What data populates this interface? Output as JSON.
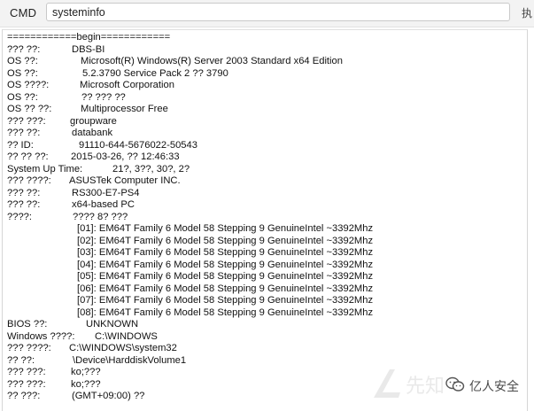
{
  "toolbar": {
    "label": "CMD",
    "input_value": "systeminfo",
    "run_button_label": "执"
  },
  "output": {
    "lines": [
      {
        "text": "============begin============",
        "indent": 0
      },
      {
        "key": "??? ??:",
        "value": "DBS-BI",
        "indent": 73
      },
      {
        "key": "OS ??:",
        "value": "Microsoft(R) Windows(R) Server 2003 Standard x64 Edition",
        "indent": 83
      },
      {
        "key": "OS ??:",
        "value": "5.2.3790 Service Pack 2 ?? 3790",
        "indent": 85
      },
      {
        "key": "OS ????:",
        "value": "Microsoft Corporation",
        "indent": 82
      },
      {
        "key": "OS ??:",
        "value": "?? ??? ??",
        "indent": 84
      },
      {
        "key": "OS ?? ??:",
        "value": "Multiprocessor Free",
        "indent": 83
      },
      {
        "key": "??? ???:",
        "value": "groupware",
        "indent": 71
      },
      {
        "key": "??? ??:",
        "value": "databank",
        "indent": 73
      },
      {
        "key": "?? ID:",
        "value": "91110-644-5676022-50543",
        "indent": 81
      },
      {
        "key": "?? ?? ??:",
        "value": "2015-03-26, ?? 12:46:33",
        "indent": 72
      },
      {
        "key": "System Up Time:",
        "value": "21?, 3??, 30?, 2?",
        "indent": 119
      },
      {
        "key": "??? ????:",
        "value": "ASUSTek Computer INC.",
        "indent": 70
      },
      {
        "key": "??? ??:",
        "value": "RS300-E7-PS4",
        "indent": 73
      },
      {
        "key": "??? ??:",
        "value": "x64-based PC",
        "indent": 73
      },
      {
        "key": "????:",
        "value": "???? 8? ???",
        "indent": 74
      },
      {
        "text": "[01]: EM64T Family 6 Model 58 Stepping 9 GenuineIntel ~3392Mhz",
        "indent": 79
      },
      {
        "text": "[02]: EM64T Family 6 Model 58 Stepping 9 GenuineIntel ~3392Mhz",
        "indent": 79
      },
      {
        "text": "[03]: EM64T Family 6 Model 58 Stepping 9 GenuineIntel ~3392Mhz",
        "indent": 79
      },
      {
        "text": "[04]: EM64T Family 6 Model 58 Stepping 9 GenuineIntel ~3392Mhz",
        "indent": 79
      },
      {
        "text": "[05]: EM64T Family 6 Model 58 Stepping 9 GenuineIntel ~3392Mhz",
        "indent": 79
      },
      {
        "text": "[06]: EM64T Family 6 Model 58 Stepping 9 GenuineIntel ~3392Mhz",
        "indent": 79
      },
      {
        "text": "[07]: EM64T Family 6 Model 58 Stepping 9 GenuineIntel ~3392Mhz",
        "indent": 79
      },
      {
        "text": "[08]: EM64T Family 6 Model 58 Stepping 9 GenuineIntel ~3392Mhz",
        "indent": 79
      },
      {
        "key": "BIOS ??:",
        "value": "UNKNOWN",
        "indent": 89
      },
      {
        "key": "Windows ????:",
        "value": "C:\\WINDOWS",
        "indent": 99
      },
      {
        "key": "??? ????:",
        "value": "C:\\WINDOWS\\system32",
        "indent": 70
      },
      {
        "key": "?? ??:",
        "value": "\\Device\\HarddiskVolume1",
        "indent": 74
      },
      {
        "key": "??? ???:",
        "value": "ko;???",
        "indent": 72
      },
      {
        "key": "??? ???:",
        "value": "ko;???",
        "indent": 72
      },
      {
        "key": "?? ???:",
        "value": "(GMT+09:00) ??",
        "indent": 73
      }
    ]
  },
  "watermark": {
    "text": "亿人安全",
    "icon": "wechat-icon",
    "logo": "watermark-logo-icon",
    "logo_text": "先知"
  }
}
